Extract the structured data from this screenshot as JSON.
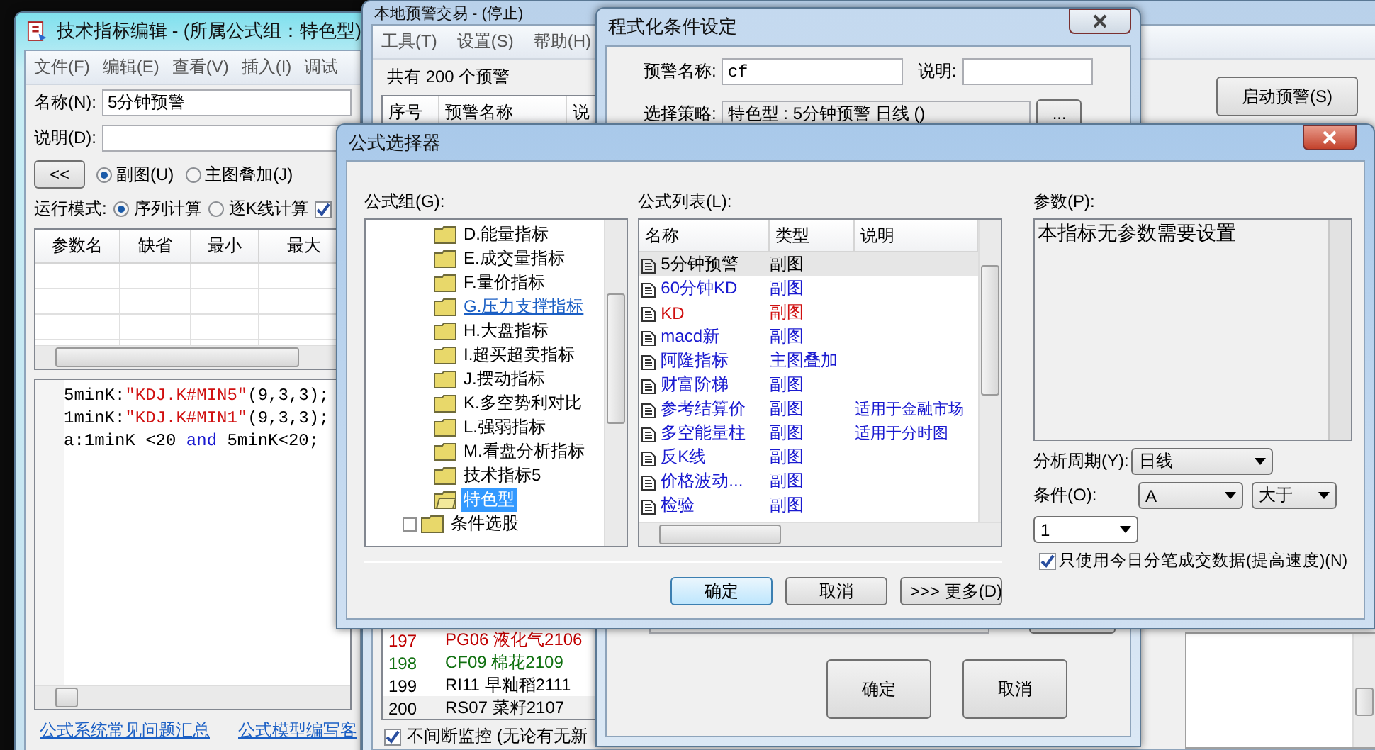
{
  "editor_window": {
    "title": "技术指标编辑 - (所属公式组：特色型)",
    "menu": [
      "文件(F)",
      "编辑(E)",
      "查看(V)",
      "插入(I)",
      "调试"
    ],
    "name_label": "名称(N):",
    "name_value": "5分钟预警",
    "desc_label": "说明(D):",
    "collapse_button": "<<",
    "chart_types": [
      {
        "label": "副图(U)",
        "selected": true
      },
      {
        "label": "主图叠加(J)",
        "selected": false
      }
    ],
    "run_mode_label": "运行模式:",
    "run_modes": [
      {
        "label": "序列计算",
        "selected": true
      },
      {
        "label": "逐K线计算",
        "selected": false
      }
    ],
    "option_checked": true,
    "param_columns": [
      "参数名",
      "缺省",
      "最小",
      "最大"
    ],
    "code_lines": [
      [
        {
          "text": "5minK:",
          "kind": "plain"
        },
        {
          "text": "\"KDJ.K#MIN5\"",
          "kind": "string"
        },
        {
          "text": "(9,3,3);",
          "kind": "plain"
        }
      ],
      [
        {
          "text": "1minK:",
          "kind": "plain"
        },
        {
          "text": "\"KDJ.K#MIN1\"",
          "kind": "string"
        },
        {
          "text": "(9,3,3);",
          "kind": "plain"
        }
      ],
      [
        {
          "text": "a:1minK <20 ",
          "kind": "plain"
        },
        {
          "text": "and",
          "kind": "keyword"
        },
        {
          "text": " 5minK<20;",
          "kind": "plain"
        }
      ]
    ],
    "links": [
      "公式系统常见问题汇总",
      "公式模型编写客"
    ]
  },
  "alert_window": {
    "title": "本地预警交易 - (停止)",
    "menu": [
      "工具(T)",
      "设置(S)",
      "帮助(H)"
    ],
    "count_text": "共有 200 个预警",
    "columns": [
      "序号",
      "预警名称",
      "说"
    ],
    "rows": [
      {
        "number": "197",
        "name": "PG06 液化气2106",
        "color": "#c00000",
        "selected": false
      },
      {
        "number": "198",
        "name": "CF09 棉花2109",
        "color": "#107010",
        "selected": false
      },
      {
        "number": "199",
        "name": "RI11 早籼稻2111",
        "color": "#000000",
        "selected": false
      },
      {
        "number": "200",
        "name": "RS07 菜籽2107",
        "color": "#000000",
        "selected": true
      }
    ],
    "monitor": {
      "label": "不间断监控 (无论有无新",
      "checked": true
    },
    "start_button": "启动预警(S)"
  },
  "condition_dialog": {
    "title": "程式化条件设定",
    "name_label": "预警名称:",
    "name_value": "cf",
    "desc_label": "说明:",
    "strategy_label": "选择策略:",
    "strategy_value": "特色型 : 5分钟预警 日线 ()",
    "browse_button": "...",
    "buttons": [
      "确定",
      "取消"
    ]
  },
  "formula_dialog": {
    "title": "公式选择器",
    "group_label": "公式组(G):",
    "list_label": "公式列表(L):",
    "param_label": "参数(P):",
    "tree": [
      {
        "children": [
          {
            "label": "D.能量指标",
            "selected": false,
            "hovered": false
          },
          {
            "label": "E.成交量指标",
            "selected": false,
            "hovered": false
          },
          {
            "label": "F.量价指标",
            "selected": false,
            "hovered": false
          },
          {
            "label": "G.压力支撑指标",
            "selected": false,
            "hovered": true
          },
          {
            "label": "H.大盘指标",
            "selected": false,
            "hovered": false
          },
          {
            "label": "I.超买超卖指标",
            "selected": false,
            "hovered": false
          },
          {
            "label": "J.摆动指标",
            "selected": false,
            "hovered": false
          },
          {
            "label": "K.多空势利对比",
            "selected": false,
            "hovered": false
          },
          {
            "label": "L.强弱指标",
            "selected": false,
            "hovered": false
          },
          {
            "label": "M.看盘分析指标",
            "selected": false,
            "hovered": false
          },
          {
            "label": "技术指标5",
            "selected": false,
            "hovered": false
          },
          {
            "label": "特色型",
            "selected": true,
            "hovered": false
          }
        ]
      },
      {
        "label": "条件选股",
        "expanded": false,
        "selected": false,
        "hovered": false
      }
    ],
    "list_columns": [
      "名称",
      "类型",
      "说明"
    ],
    "formulas": [
      {
        "name": "5分钟预警",
        "type": "副图",
        "color": "#000000",
        "selected": true
      },
      {
        "name": "60分钟KD",
        "type": "副图",
        "color": "#1a1ad0",
        "selected": false
      },
      {
        "name": "KD",
        "type": "副图",
        "color": "#d01010",
        "selected": false
      },
      {
        "name": "macd新",
        "type": "副图",
        "color": "#1a1ad0",
        "selected": false
      },
      {
        "name": "阿隆指标",
        "type": "主图叠加",
        "color": "#1a1ad0",
        "selected": false
      },
      {
        "name": "财富阶梯",
        "type": "副图",
        "color": "#1a1ad0",
        "selected": false
      },
      {
        "name": "参考结算价",
        "type": "副图",
        "note": "适用于金融市场",
        "color": "#1a1ad0",
        "selected": false
      },
      {
        "name": "多空能量柱",
        "type": "副图",
        "note": "适用于分时图",
        "color": "#1a1ad0",
        "selected": false
      },
      {
        "name": "反K线",
        "type": "副图",
        "color": "#1a1ad0",
        "selected": false
      },
      {
        "name": "价格波动...",
        "type": "副图",
        "color": "#1a1ad0",
        "selected": false
      },
      {
        "name": "检验",
        "type": "副图",
        "color": "#1a1ad0",
        "selected": false
      }
    ],
    "param_text": "本指标无参数需要设置",
    "period": {
      "label": "分析周期(Y):",
      "value": "日线"
    },
    "condition": {
      "label": "条件(O):",
      "value": "A",
      "operator": "大于",
      "threshold": "1"
    },
    "fast_mode": {
      "label": "只使用今日分笔成交数据(提高速度)(N)",
      "checked": true
    },
    "buttons": [
      {
        "label": "确定",
        "default": true
      },
      {
        "label": "取消",
        "default": false
      },
      {
        "label": ">>> 更多(D)",
        "default": false
      }
    ]
  }
}
